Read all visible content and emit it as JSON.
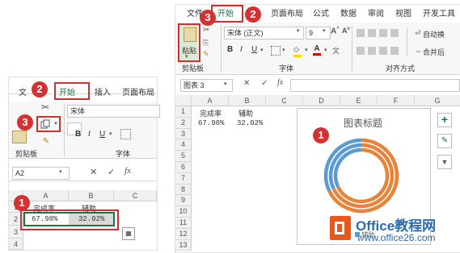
{
  "left": {
    "tabs": {
      "file": "文",
      "home": "开始",
      "insert": "插入",
      "page_layout": "页面布局"
    },
    "font_name": "宋体",
    "groups": {
      "clipboard": "剪贴板",
      "font": "字体"
    },
    "name_box": "A2",
    "columns": [
      "A",
      "B",
      "C"
    ],
    "rows": [
      "1",
      "2",
      "3",
      "4"
    ],
    "cells": {
      "A1": "完成率",
      "B1": "辅助",
      "A2": "67.98%",
      "B2": "32.02%"
    },
    "badges": [
      "1",
      "2",
      "3"
    ]
  },
  "right": {
    "tabs": {
      "file": "文件",
      "home": "开始",
      "insert": "插入",
      "page_layout": "页面布局",
      "formulas": "公式",
      "data": "数据",
      "review": "审阅",
      "view": "视图",
      "developer": "开发工具"
    },
    "paste_label": "粘贴",
    "font_name": "宋体 (正文)",
    "font_size": "9",
    "groups": {
      "clipboard": "剪贴板",
      "font": "字体",
      "alignment": "对齐方式"
    },
    "wrap_text": "自动换",
    "merge": "合并后",
    "name_box": "图表 3",
    "columns": [
      "A",
      "B",
      "C",
      "D",
      "E",
      "F",
      "G"
    ],
    "rows": [
      "1",
      "2",
      "3",
      "4",
      "5",
      "6",
      "7",
      "8",
      "9",
      "10",
      "11",
      "12",
      "13"
    ],
    "cells": {
      "A1": "完成率",
      "B1": "辅助",
      "A2": "67.98%",
      "B2": "32.02%"
    },
    "chart_title": "图表标题",
    "legend": "辅助",
    "badges": [
      "1",
      "2",
      "3"
    ]
  },
  "chart_data": {
    "type": "doughnut",
    "title": "图表标题",
    "series": [
      {
        "name": "辅助",
        "values": [
          67.98,
          32.02
        ]
      },
      {
        "name": "",
        "values": [
          67.98,
          32.02
        ]
      },
      {
        "name": "",
        "values": [
          67.98,
          32.02
        ]
      }
    ],
    "colors": [
      "#e8833a",
      "#5b9bd5"
    ]
  },
  "watermark": {
    "brand": "Office教程网",
    "url": "www.office26.com",
    "logo_color": "#e8571c"
  }
}
